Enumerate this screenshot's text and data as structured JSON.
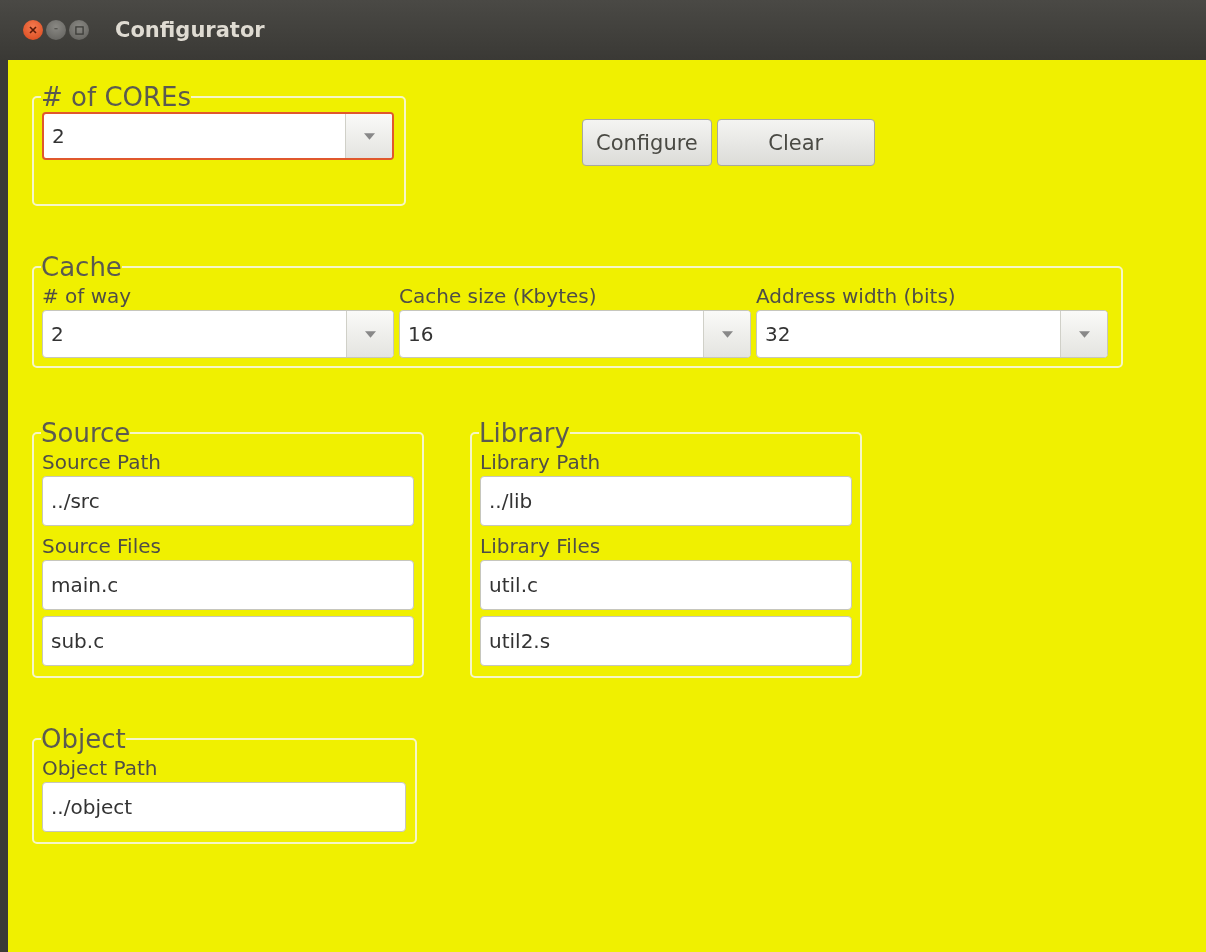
{
  "window": {
    "title": "Configurator"
  },
  "cores": {
    "legend": "# of COREs",
    "combo": {
      "value": "2",
      "focused": true
    }
  },
  "buttons": [
    "Configure",
    "Clear"
  ],
  "cache": {
    "legend": "Cache",
    "fields": [
      {
        "label": "# of way",
        "value": "2"
      },
      {
        "label": "Cache size (Kbytes)",
        "value": "16"
      },
      {
        "label": "Address width (bits)",
        "value": "32"
      }
    ]
  },
  "source": {
    "legend": "Source",
    "path_label": "Source Path",
    "path": "../src",
    "files_label": "Source Files",
    "files": [
      "main.c",
      "sub.c"
    ]
  },
  "library": {
    "legend": "Library",
    "path_label": "Library Path",
    "path": "../lib",
    "files_label": "Library Files",
    "files": [
      "util.c",
      "util2.s"
    ]
  },
  "object": {
    "legend": "Object",
    "path_label": "Object Path",
    "path": "../object"
  }
}
